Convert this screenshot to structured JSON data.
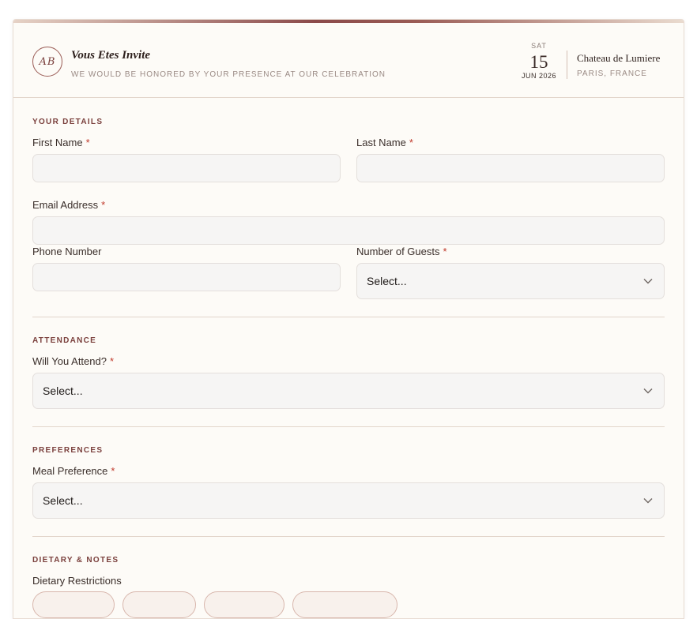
{
  "header": {
    "monogram": "AB",
    "title": "Vous Etes Invite",
    "subtitle": "WE WOULD BE HONORED BY YOUR PRESENCE AT OUR CELEBRATION",
    "date": {
      "weekday": "SAT",
      "day": "15",
      "month_year": "JUN 2026"
    },
    "venue": {
      "name": "Chateau de Lumiere",
      "location": "PARIS, FRANCE"
    }
  },
  "sections": {
    "details": {
      "label": "YOUR DETAILS",
      "first_name": {
        "label": "First Name",
        "value": ""
      },
      "last_name": {
        "label": "Last Name",
        "value": ""
      },
      "email": {
        "label": "Email Address",
        "value": ""
      },
      "phone": {
        "label": "Phone Number",
        "value": ""
      },
      "guests": {
        "label": "Number of Guests",
        "selected": "Select..."
      }
    },
    "attendance": {
      "label": "ATTENDANCE",
      "attend": {
        "label": "Will You Attend?",
        "selected": "Select..."
      }
    },
    "preferences": {
      "label": "PREFERENCES",
      "meal": {
        "label": "Meal Preference",
        "selected": "Select..."
      }
    },
    "dietary": {
      "label": "DIETARY & NOTES",
      "restrictions_label": "Dietary Restrictions"
    }
  },
  "required_marker": "*",
  "colors": {
    "accent": "#7a3f3c",
    "required": "#c0392b",
    "card_bg": "#fdfbf7",
    "input_bg": "#f6f5f4"
  }
}
